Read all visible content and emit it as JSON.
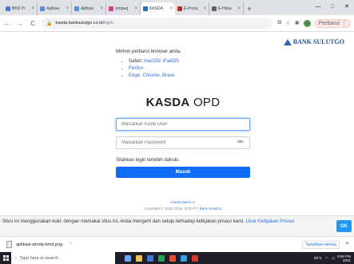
{
  "browser": {
    "tabs": [
      {
        "title": "BKD Pr",
        "color": "#4a7bd0",
        "active": false
      },
      {
        "title": "Aplikas",
        "color": "#5b8ed8",
        "active": false
      },
      {
        "title": "Aplikas",
        "color": "#5b8ed8",
        "active": false
      },
      {
        "title": "simpeg",
        "color": "#d93a8b",
        "active": false
      },
      {
        "title": "KASDA",
        "color": "#2f69b3",
        "active": true
      },
      {
        "title": "E-Procu",
        "color": "#c62828",
        "active": false
      },
      {
        "title": "E-Heka",
        "color": "#5f6368",
        "active": false
      }
    ],
    "new_tab": "+",
    "window_controls": [
      "—",
      "□",
      "✕"
    ],
    "nav": {
      "back": "←",
      "forward": "→",
      "reload": "C"
    },
    "url_host": "kasda.banksulutgo.co.id",
    "url_path": "/login",
    "profile_letter": "S",
    "update_label": "Perbarui",
    "update_menu": "⋮"
  },
  "page": {
    "brand": "BANK SULUTGO",
    "notice_text": "Mohon perbarui browser anda.",
    "browsers": [
      {
        "name": "Safari: ",
        "link": "macOS/ iPadOS"
      },
      {
        "name": "",
        "link": "Firefox"
      },
      {
        "name": "",
        "link": "Edge, Chrome, Brave"
      }
    ],
    "title_bold": "KASDA",
    "title_rest": " OPD",
    "user_placeholder": "Masukkan Kode User",
    "password_placeholder": "Masukkan Password",
    "password_hint_badge": "abc",
    "login_hint": "Silahkan login terlebih dahulu.",
    "login_button": "Masuk",
    "demo_link": "Kasda Demo ✔",
    "copyright": "Copyright © 2018, 2019, 2020 PT. ",
    "copyright_link": "Bank SulutGo"
  },
  "cookie": {
    "text": "Situs ini menggunakan kuki: dengan memakai situs ini, Anda mengerti dan setuju terhadap kebijakan privasi kami. ",
    "link": "Lihat Kebijakan Privasi",
    "ok": "OK"
  },
  "downloads": {
    "file": "aplikasi-simda-bmd.png",
    "caret": "^",
    "show_all": "Tampilkan semua",
    "close": "✕"
  },
  "taskbar": {
    "search_placeholder": "Type here to search",
    "apps": [
      "#6aa9ff",
      "#f2c14e",
      "#3a7bd5",
      "#2e9e5b",
      "#e94f35",
      "#37a0e0",
      "#d8392b"
    ],
    "temp": "28°C",
    "time": "9:50 PM",
    "date": "2021"
  }
}
